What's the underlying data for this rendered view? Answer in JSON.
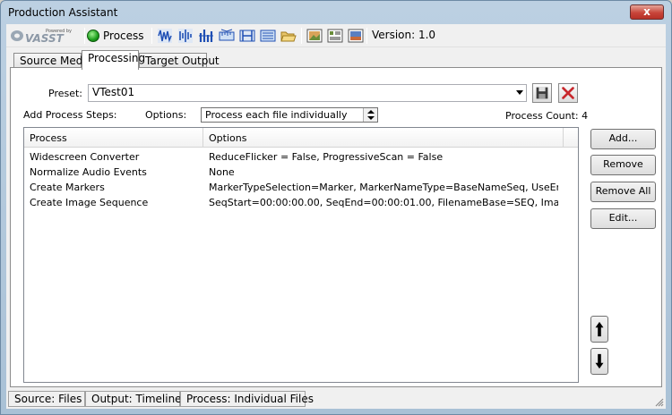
{
  "window": {
    "title": "Production Assistant",
    "close_label": "x"
  },
  "toolbar": {
    "logo_small": "Powered by",
    "logo_text": "VASST",
    "process_label": "Process",
    "version": "Version: 1.0",
    "icons": [
      "waveform-icon",
      "audio-wave-icon",
      "bars-icon",
      "ruler-icon",
      "marker-icon",
      "film-icon",
      "folder-open-icon",
      "image-icon",
      "list-icon",
      "picture-icon"
    ]
  },
  "tabs": [
    {
      "label": "Source Media"
    },
    {
      "label": "Processing"
    },
    {
      "label": "Target Output"
    }
  ],
  "panel": {
    "preset_label": "Preset:",
    "preset_value": "VTest01",
    "add_steps_label": "Add Process Steps:",
    "options_label": "Options:",
    "options_value": "Process each file individually",
    "process_count": "Process Count: 4"
  },
  "list": {
    "columns": [
      "Process",
      "Options"
    ],
    "rows": [
      {
        "process": "Widescreen Converter",
        "options": "ReduceFlicker = False, ProgressiveScan = False"
      },
      {
        "process": "Normalize Audio Events",
        "options": "None"
      },
      {
        "process": "Create Markers",
        "options": "MarkerTypeSelection=Marker, MarkerNameType=BaseNameSeq, UseEntireProj..."
      },
      {
        "process": "Create Image Sequence",
        "options": "SeqStart=00:00:00.00, SeqEnd=00:00:01.00, FilenameBase=SEQ, ImageFormat..."
      }
    ]
  },
  "buttons": {
    "add": "Add...",
    "remove": "Remove",
    "remove_all": "Remove All",
    "edit": "Edit..."
  },
  "status": {
    "source": "Source: Files",
    "output": "Output: Timeline",
    "process": "Process: Individual Files"
  }
}
